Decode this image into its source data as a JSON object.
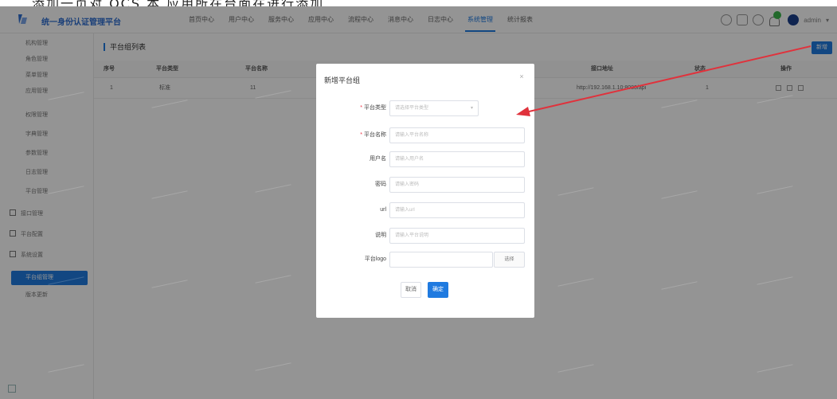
{
  "caption": "添加一页对 OCS 本 应用所在台面在进行添加",
  "header": {
    "app_title": "统一身份认证管理平台",
    "nav": [
      {
        "label": "首页中心",
        "active": false
      },
      {
        "label": "用户中心",
        "active": false
      },
      {
        "label": "服务中心",
        "active": false
      },
      {
        "label": "应用中心",
        "active": false
      },
      {
        "label": "流程中心",
        "active": false
      },
      {
        "label": "消息中心",
        "active": false
      },
      {
        "label": "日志中心",
        "active": false
      },
      {
        "label": "系统管理",
        "active": true
      },
      {
        "label": "统计报表",
        "active": false
      }
    ],
    "user_name": "admin"
  },
  "sidebar": {
    "items": [
      {
        "label": "机构管理",
        "type": "item",
        "active": false
      },
      {
        "label": "角色管理",
        "type": "item",
        "active": false
      },
      {
        "label": "菜单管理",
        "type": "item",
        "active": false
      },
      {
        "label": "应用管理",
        "type": "item",
        "active": false
      },
      {
        "label": "权限管理",
        "type": "item",
        "active": false
      },
      {
        "label": "字典管理",
        "type": "item",
        "active": false
      },
      {
        "label": "参数管理",
        "type": "item",
        "active": false
      },
      {
        "label": "日志管理",
        "type": "item",
        "active": false
      },
      {
        "label": "平台管理",
        "type": "item",
        "active": false
      },
      {
        "label": "接口管理",
        "type": "group",
        "active": false
      },
      {
        "label": "平台配置",
        "type": "group",
        "active": false
      },
      {
        "label": "系统设置",
        "type": "group",
        "active": false
      },
      {
        "label": "平台组管理",
        "type": "item",
        "active": true
      },
      {
        "label": "版本更新",
        "type": "item",
        "active": false
      }
    ]
  },
  "main": {
    "title": "平台组列表",
    "add_label": "新增",
    "columns": [
      "序号",
      "平台类型",
      "平台名称",
      "",
      "",
      "",
      "接口地址",
      "状态",
      "操作"
    ],
    "rows": [
      {
        "index": "1",
        "type": "标准",
        "name": "11",
        "url": "http://192.168.1.10:8080/api",
        "status": "1"
      }
    ]
  },
  "modal": {
    "title": "新增平台组",
    "close_label": "×",
    "fields": [
      {
        "label": "平台类型",
        "required": true,
        "placeholder": "请选择平台类型",
        "kind": "select"
      },
      {
        "label": "平台名称",
        "required": true,
        "placeholder": "请输入平台名称",
        "kind": "input"
      },
      {
        "label": "用户名",
        "required": false,
        "placeholder": "请输入用户名",
        "kind": "input"
      },
      {
        "label": "密码",
        "required": false,
        "placeholder": "请输入密码",
        "kind": "input"
      },
      {
        "label": "url",
        "required": false,
        "placeholder": "请输入url",
        "kind": "input"
      },
      {
        "label": "说明",
        "required": false,
        "placeholder": "请输入平台说明",
        "kind": "input"
      },
      {
        "label": "平台logo",
        "required": false,
        "placeholder": "",
        "kind": "upload"
      }
    ],
    "upload_label": "选择",
    "cancel_label": "取消",
    "confirm_label": "确定"
  },
  "colors": {
    "accent": "#1f7ae0",
    "annotation_arrow": "#e0323c",
    "notification": "#3cb54a"
  }
}
